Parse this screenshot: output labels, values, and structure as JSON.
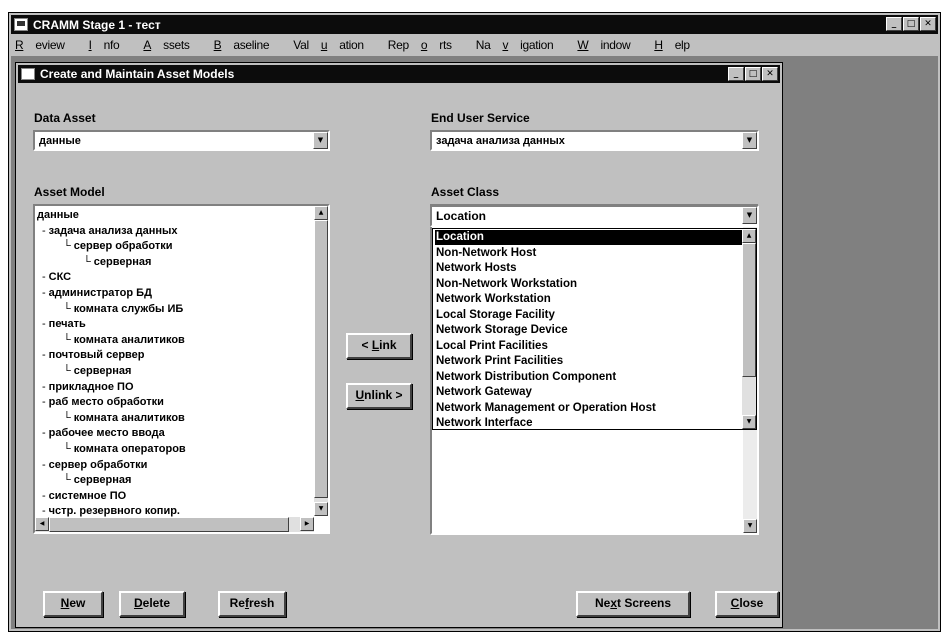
{
  "app": {
    "title": "CRAMM Stage 1 - тест"
  },
  "window_controls": {
    "minimize": "_",
    "maximize": "□",
    "close": "✕"
  },
  "menu": [
    {
      "label": "Review",
      "key": "R",
      "rest": "eview"
    },
    {
      "label": "Info",
      "key": "I",
      "rest": "nfo"
    },
    {
      "label": "Assets",
      "key": "A",
      "rest": "ssets"
    },
    {
      "label": "Baseline",
      "key": "B",
      "rest": "aseline"
    },
    {
      "label": "Valuation",
      "pre": "Val",
      "key": "u",
      "rest": "ation"
    },
    {
      "label": "Reports",
      "pre": "Rep",
      "key": "o",
      "rest": "rts"
    },
    {
      "label": "Navigation",
      "pre": "Na",
      "key": "v",
      "rest": "igation"
    },
    {
      "label": "Window",
      "key": "W",
      "rest": "indow"
    },
    {
      "label": "Help",
      "key": "H",
      "rest": "elp"
    }
  ],
  "child_window": {
    "title": "Create and Maintain Asset Models"
  },
  "data_asset": {
    "label": "Data Asset",
    "value": "данные"
  },
  "end_user_service": {
    "label": "End User Service",
    "value": "задача анализа данных"
  },
  "asset_model": {
    "label": "Asset Model",
    "items": [
      {
        "text": "данные",
        "level": 0,
        "connector": ""
      },
      {
        "text": "задача анализа данных",
        "level": 1,
        "connector": "-"
      },
      {
        "text": "сервер обработки",
        "level": 2,
        "connector": "└"
      },
      {
        "text": "серверная",
        "level": 3,
        "connector": "└"
      },
      {
        "text": "СКС",
        "level": 1,
        "connector": "-"
      },
      {
        "text": "администратор БД",
        "level": 1,
        "connector": "-"
      },
      {
        "text": "комната службы ИБ",
        "level": 2,
        "connector": "└"
      },
      {
        "text": "печать",
        "level": 1,
        "connector": "-"
      },
      {
        "text": "комната аналитиков",
        "level": 2,
        "connector": "└"
      },
      {
        "text": "почтовый сервер",
        "level": 1,
        "connector": "-"
      },
      {
        "text": "серверная",
        "level": 2,
        "connector": "└"
      },
      {
        "text": "прикладное ПО",
        "level": 1,
        "connector": "-"
      },
      {
        "text": "раб место обработки",
        "level": 1,
        "connector": "-"
      },
      {
        "text": "комната аналитиков",
        "level": 2,
        "connector": "└"
      },
      {
        "text": "рабочее место ввода",
        "level": 1,
        "connector": "-"
      },
      {
        "text": "комната операторов",
        "level": 2,
        "connector": "└"
      },
      {
        "text": "сервер обработки",
        "level": 1,
        "connector": "-"
      },
      {
        "text": "серверная",
        "level": 2,
        "connector": "└"
      },
      {
        "text": "системное ПО",
        "level": 1,
        "connector": "-"
      },
      {
        "text": "чстр. резервного копир.",
        "level": 1,
        "connector": "-"
      }
    ]
  },
  "asset_class": {
    "label": "Asset Class",
    "value": "Location",
    "options": [
      "Location",
      "Non-Network Host",
      "Network Hosts",
      "Non-Network Workstation",
      "Network Workstation",
      "Local Storage Facility",
      "Network Storage Device",
      "Local Print Facilities",
      "Network Print Facilities",
      "Network Distribution Component",
      "Network Gateway",
      "Network Management or Operation Host",
      "Network Interface"
    ]
  },
  "buttons": {
    "link": {
      "label": "< Link",
      "pre": "< ",
      "key": "L",
      "rest": "ink"
    },
    "unlink": {
      "label": "Unlink >",
      "key": "U",
      "rest": "nlink >"
    },
    "new": {
      "label": "New",
      "key": "N",
      "rest": "ew"
    },
    "delete": {
      "label": "Delete",
      "key": "D",
      "rest": "elete"
    },
    "refresh": {
      "label": "Refresh",
      "pre": "Re",
      "key": "f",
      "rest": "resh"
    },
    "next_screens": {
      "label": "Next Screens",
      "pre": "Ne",
      "key": "x",
      "rest": "t Screens"
    },
    "close": {
      "label": "Close",
      "key": "C",
      "rest": "lose"
    }
  },
  "icons": {
    "combo_arrow": "▼",
    "scroll_up": "▲",
    "scroll_down": "▼",
    "scroll_left": "◀",
    "scroll_right": "▶"
  }
}
